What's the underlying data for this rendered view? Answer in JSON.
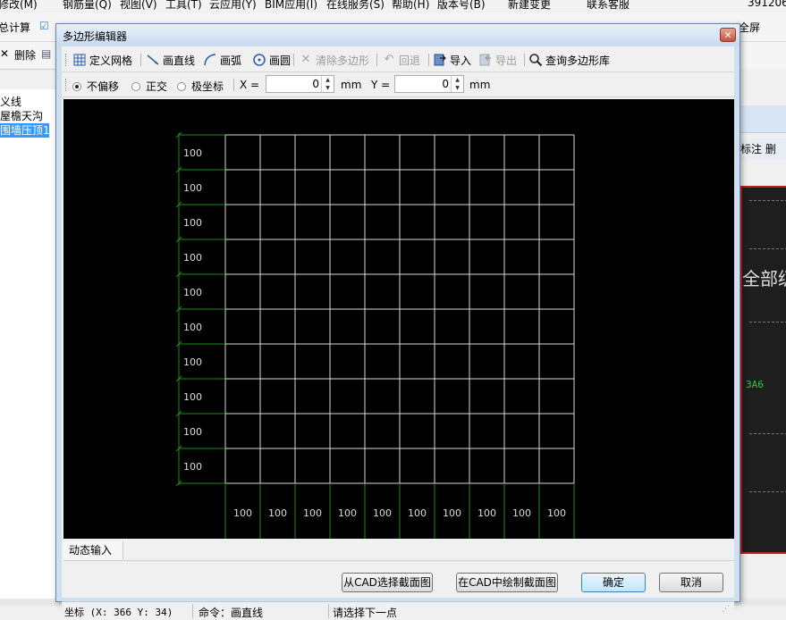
{
  "background": {
    "menu": [
      "修改(M)",
      "钢筋量(Q)",
      "视图(V)",
      "工具(T)",
      "云应用(Y)",
      "BIM应用(I)",
      "在线服务(S)",
      "帮助(H)",
      "版本号(B)",
      "新建变更",
      "联系客服",
      "391206"
    ],
    "toolbar_left": "总计算",
    "toolbar_right": "全屏",
    "delete_label": "删除",
    "tree_items": [
      "义线",
      "屋檐天沟",
      "围墙压顶1"
    ],
    "right_label": "标注",
    "right_label2": "删",
    "right_big_text": "全部级",
    "right_green_text": "3A6"
  },
  "dialog": {
    "title": "多边形编辑器",
    "close_glyph": "✕",
    "toolbar": {
      "define_grid": "定义网格",
      "draw_line": "画直线",
      "draw_arc": "画弧",
      "draw_circle": "画圆",
      "clear_polygon": "清除多边形",
      "undo": "回退",
      "import": "导入",
      "export": "导出",
      "query_library": "查询多边形库"
    },
    "offset": {
      "no_offset": "不偏移",
      "ortho": "正交",
      "polar": "极坐标",
      "x_label": "X =",
      "x_value": "0",
      "y_label": "Y =",
      "y_value": "0",
      "unit": "mm",
      "selected": "no_offset"
    },
    "grid": {
      "rows": [
        "100",
        "100",
        "100",
        "100",
        "100",
        "100",
        "100",
        "100",
        "100",
        "100"
      ],
      "cols": [
        "100",
        "100",
        "100",
        "100",
        "100",
        "100",
        "100",
        "100",
        "100",
        "100"
      ]
    },
    "dynamic_input": "动态输入",
    "buttons": {
      "select_from_cad": "从CAD选择截面图",
      "draw_in_cad": "在CAD中绘制截面图",
      "ok": "确定",
      "cancel": "取消"
    },
    "status": {
      "coords": "坐标 (X: 366 Y: 34)",
      "command": "命令：画直线",
      "prompt": "请选择下一点"
    },
    "colors": {
      "canvas": "#000000",
      "grid_line": "#d9d9d9",
      "dimension_line": "#1f8a1f",
      "label": "#dcdcdc"
    }
  }
}
